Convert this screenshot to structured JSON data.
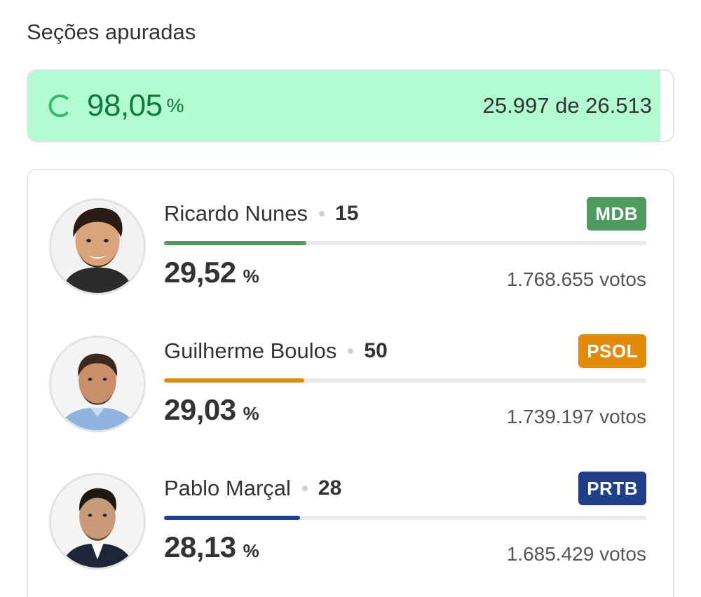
{
  "header": {
    "title": "Seções apuradas"
  },
  "apuracao": {
    "percent": "98,05",
    "percent_sign": "%",
    "percent_value": 98.05,
    "counted_text": "25.997 de 26.513",
    "fill_color": "#b3fbd1",
    "text_color": "#0e7a3c"
  },
  "candidates": [
    {
      "name": "Ricardo Nunes",
      "number": "15",
      "party": "MDB",
      "party_color": "#4e9a5f",
      "percent": "29,52",
      "percent_sign": "%",
      "percent_value": 29.52,
      "votes": "1.768.655 votos",
      "bar_color": "#4e9a5f",
      "photo": "candidate-photo"
    },
    {
      "name": "Guilherme Boulos",
      "number": "50",
      "party": "PSOL",
      "party_color": "#e18a0c",
      "percent": "29,03",
      "percent_sign": "%",
      "percent_value": 29.03,
      "votes": "1.739.197 votos",
      "bar_color": "#e18a0c",
      "photo": "candidate-photo"
    },
    {
      "name": "Pablo Marçal",
      "number": "28",
      "party": "PRTB",
      "party_color": "#1f3f8a",
      "percent": "28,13",
      "percent_sign": "%",
      "percent_value": 28.13,
      "votes": "1.685.429 votos",
      "bar_color": "#1f3f8a",
      "photo": "candidate-photo"
    }
  ]
}
